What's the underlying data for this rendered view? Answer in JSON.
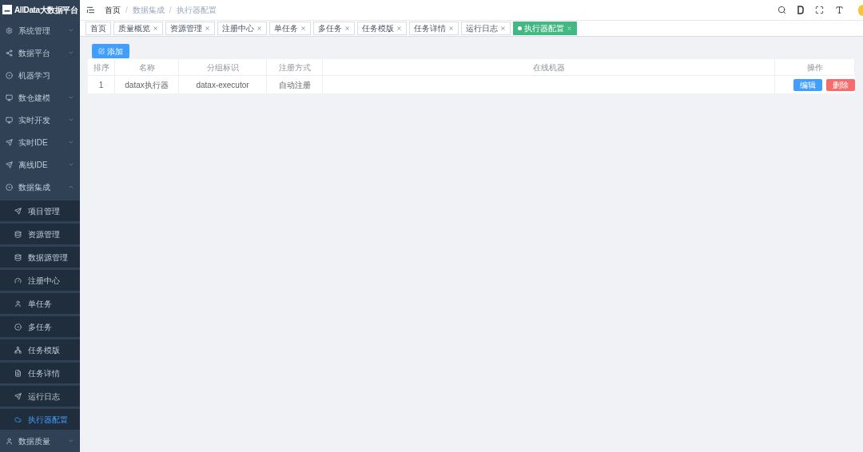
{
  "logo": {
    "title": "AllData大数据平台"
  },
  "sidebar": {
    "items": [
      {
        "label": "系统管理",
        "expanded": false
      },
      {
        "label": "数据平台",
        "expanded": false
      },
      {
        "label": "机器学习"
      },
      {
        "label": "数仓建模",
        "expanded": false
      },
      {
        "label": "实时开发",
        "expanded": false
      },
      {
        "label": "实时IDE",
        "expanded": false
      },
      {
        "label": "离线IDE",
        "expanded": false
      },
      {
        "label": "数据集成",
        "expanded": true,
        "children": [
          {
            "label": "项目管理",
            "selected": false
          },
          {
            "label": "资源管理",
            "selected": false
          },
          {
            "label": "数据源管理",
            "selected": false
          },
          {
            "label": "注册中心",
            "selected": false
          },
          {
            "label": "单任务",
            "selected": false
          },
          {
            "label": "多任务",
            "selected": false
          },
          {
            "label": "任务模版",
            "selected": false
          },
          {
            "label": "任务详情",
            "selected": false
          },
          {
            "label": "运行日志",
            "selected": false
          },
          {
            "label": "执行器配置",
            "selected": true
          }
        ]
      },
      {
        "label": "数据质量",
        "expanded": false
      }
    ]
  },
  "breadcrumb": {
    "separator": "/",
    "items": [
      "首页",
      "数据集成",
      "执行器配置"
    ]
  },
  "tags": [
    {
      "label": "首页",
      "closable": false,
      "selected": false
    },
    {
      "label": "质量概览",
      "closable": true,
      "selected": false
    },
    {
      "label": "资源管理",
      "closable": true,
      "selected": false
    },
    {
      "label": "注册中心",
      "closable": true,
      "selected": false
    },
    {
      "label": "单任务",
      "closable": true,
      "selected": false
    },
    {
      "label": "多任务",
      "closable": true,
      "selected": false
    },
    {
      "label": "任务模版",
      "closable": true,
      "selected": false
    },
    {
      "label": "任务详情",
      "closable": true,
      "selected": false
    },
    {
      "label": "运行日志",
      "closable": true,
      "selected": false
    },
    {
      "label": "执行器配置",
      "closable": true,
      "selected": true
    }
  ],
  "add_button": "添加",
  "table": {
    "columns": [
      "排序",
      "名称",
      "分组标识",
      "注册方式",
      "在线机器",
      "操作"
    ],
    "rows": [
      {
        "cells": [
          "1",
          "datax执行器",
          "datax-executor",
          "自动注册"
        ],
        "actions": [
          "编辑",
          "删除"
        ]
      }
    ]
  }
}
